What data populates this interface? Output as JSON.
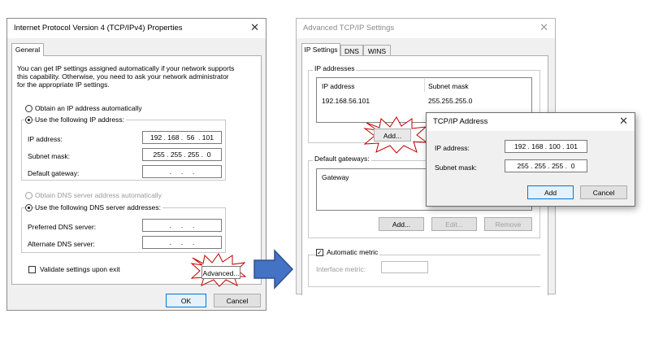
{
  "ipv4": {
    "title": "Internet Protocol Version 4 (TCP/IPv4) Properties",
    "close": "✕",
    "tab_general": "General",
    "description": [
      "You can get IP settings assigned automatically if your network supports",
      "this capability. Otherwise, you need to ask your network administrator",
      "for the appropriate IP settings."
    ],
    "obtain_ip_auto": "Obtain an IP address automatically",
    "use_following_ip": "Use the following IP address:",
    "ip_address_label": "IP address:",
    "ip_address_value": "192 . 168 .  56  . 101",
    "subnet_label": "Subnet mask:",
    "subnet_value": "255 . 255 . 255 .  0",
    "gateway_label": "Default gateway:",
    "gateway_value": "  .     .     .  ",
    "obtain_dns_auto": "Obtain DNS server address automatically",
    "use_following_dns": "Use the following DNS server addresses:",
    "preferred_dns_label": "Preferred DNS server:",
    "preferred_dns_value": "  .     .     .  ",
    "alternate_dns_label": "Alternate DNS server:",
    "alternate_dns_value": "  .     .     .  ",
    "validate_label": "Validate settings upon exit",
    "advanced_button": "Advanced...",
    "ok_button": "OK",
    "cancel_button": "Cancel"
  },
  "advanced": {
    "title": "Advanced TCP/IP Settings",
    "close": "✕",
    "tabs": [
      "IP Settings",
      "DNS",
      "WINS"
    ],
    "ip_addresses_group": "IP addresses",
    "col_ip": "IP address",
    "col_subnet": "Subnet mask",
    "row_ip": "192.168.56.101",
    "row_subnet": "255.255.255.0",
    "add_button": "Add...",
    "gateways_group": "Default gateways:",
    "col_gateway": "Gateway",
    "gw_add_button": "Add...",
    "gw_edit_button": "Edit...",
    "gw_remove_button": "Remove",
    "automatic_metric": "Automatic metric",
    "interface_metric_label": "Interface metric:"
  },
  "tcpip_popup": {
    "title": "TCP/IP Address",
    "close": "✕",
    "ip_label": "IP address:",
    "ip_value": "192 . 168 . 100 . 101",
    "subnet_label": "Subnet mask:",
    "subnet_value": "255 . 255 . 255 .  0",
    "add_button": "Add",
    "cancel_button": "Cancel"
  },
  "colors": {
    "arrow_fill": "#4472c4",
    "arrow_stroke": "#2f528f",
    "star_stroke": "#c00000",
    "primary_border": "#0078d7"
  },
  "icons": {
    "close": "close-icon",
    "arrow": "arrow-right-icon",
    "star": "starburst-icon"
  }
}
